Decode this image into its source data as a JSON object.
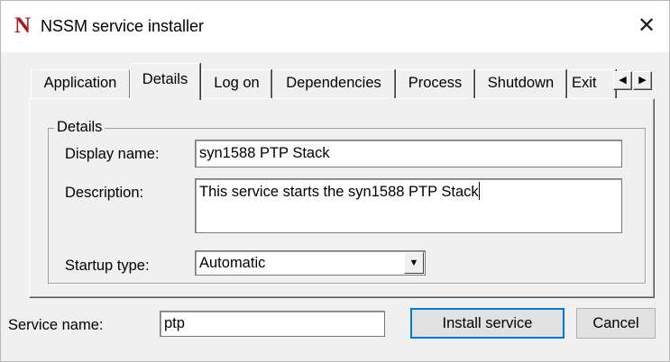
{
  "window": {
    "app_icon_glyph": "N",
    "title": "NSSM service installer",
    "close_glyph": "✕",
    "accent_color": "#0078d7",
    "icon_color": "#b01818"
  },
  "tabs": [
    {
      "label": "Application",
      "active": false
    },
    {
      "label": "Details",
      "active": true
    },
    {
      "label": "Log on",
      "active": false
    },
    {
      "label": "Dependencies",
      "active": false
    },
    {
      "label": "Process",
      "active": false
    },
    {
      "label": "Shutdown",
      "active": false
    },
    {
      "label": "Exit",
      "active": false
    }
  ],
  "tab_scroll": {
    "left_glyph": "◀",
    "right_glyph": "▶"
  },
  "details": {
    "group_label": "Details",
    "display_name_label": "Display name:",
    "display_name_value": "syn1588 PTP Stack",
    "description_label": "Description:",
    "description_value": "This service starts the syn1588 PTP Stack",
    "startup_type_label": "Startup type:",
    "startup_type_value": "Automatic",
    "dropdown_glyph": "▼"
  },
  "footer": {
    "service_name_label": "Service name:",
    "service_name_value": "ptp",
    "install_button": "Install service",
    "cancel_button": "Cancel"
  }
}
